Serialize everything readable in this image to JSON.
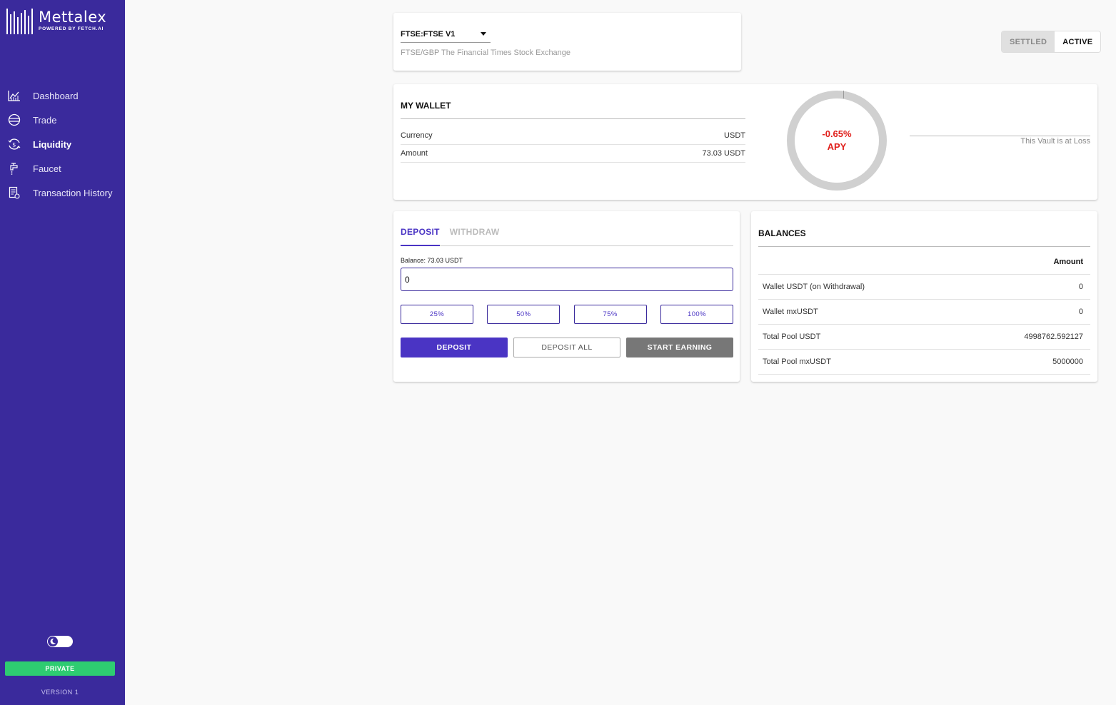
{
  "brand": {
    "name": "Mettalex",
    "tagline": "POWERED BY FETCH.AI"
  },
  "sidebar": {
    "items": [
      {
        "label": "Dashboard",
        "icon": "chart-icon",
        "active": false
      },
      {
        "label": "Trade",
        "icon": "trade-icon",
        "active": false
      },
      {
        "label": "Liquidity",
        "icon": "liquidity-icon",
        "active": true
      },
      {
        "label": "Faucet",
        "icon": "faucet-icon",
        "active": false
      },
      {
        "label": "Transaction History",
        "icon": "history-icon",
        "active": false
      }
    ],
    "theme_toggle_icon": "moon-icon",
    "badge": "PRIVATE",
    "version": "VERSION 1"
  },
  "market": {
    "selected": "FTSE:FTSE V1",
    "description": "FTSE/GBP The Financial Times Stock Exchange"
  },
  "status_toggle": {
    "settled": "SETTLED",
    "active": "ACTIVE",
    "selected": "ACTIVE"
  },
  "wallet": {
    "title": "MY WALLET",
    "rows": [
      {
        "label": "Currency",
        "value": "USDT"
      },
      {
        "label": "Amount",
        "value": "73.03 USDT"
      }
    ],
    "apy_value": "-0.65%",
    "apy_label": "APY",
    "status_text": "This Vault is at Loss"
  },
  "deposit_panel": {
    "tabs": [
      "DEPOSIT",
      "WITHDRAW"
    ],
    "active_tab": "DEPOSIT",
    "balance_label": "Balance: 73.03 USDT",
    "amount_value": "0",
    "percent_buttons": [
      "25%",
      "50%",
      "75%",
      "100%"
    ],
    "deposit_button": "DEPOSIT",
    "deposit_all_button": "DEPOSIT ALL",
    "start_earning_button": "START EARNING"
  },
  "balances": {
    "title": "BALANCES",
    "column_header": "Amount",
    "rows": [
      {
        "label": "Wallet USDT (on Withdrawal)",
        "value": "0"
      },
      {
        "label": "Wallet mxUSDT",
        "value": "0"
      },
      {
        "label": "Total Pool USDT",
        "value": "4998762.592127"
      },
      {
        "label": "Total Pool mxUSDT",
        "value": "5000000"
      }
    ]
  },
  "colors": {
    "sidebar_bg": "#3a2a9c",
    "accent": "#4a34c4",
    "loss_red": "#e0201c",
    "private_green": "#2ecc71"
  }
}
